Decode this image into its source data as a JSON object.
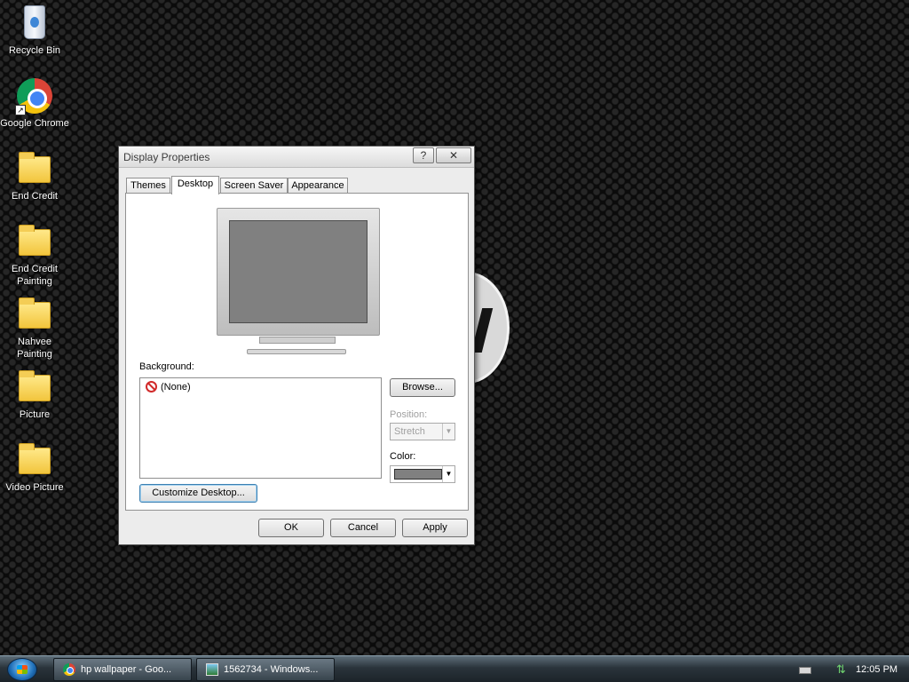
{
  "desktop": {
    "icons": [
      {
        "label": "Recycle Bin",
        "icon": "recycle-bin-icon"
      },
      {
        "label": "Google Chrome",
        "icon": "chrome-icon"
      },
      {
        "label": "End Credit",
        "icon": "folder-icon"
      },
      {
        "label": "End Credit Painting",
        "icon": "folder-icon"
      },
      {
        "label": "Nahvee Painting",
        "icon": "folder-icon"
      },
      {
        "label": "Picture",
        "icon": "folder-icon"
      },
      {
        "label": "Video Picture",
        "icon": "folder-icon"
      }
    ]
  },
  "dialog": {
    "title": "Display Properties",
    "help_glyph": "?",
    "close_glyph": "✕",
    "tabs": [
      "Themes",
      "Desktop",
      "Screen Saver",
      "Appearance"
    ],
    "active_tab": "Desktop",
    "background_label": "Background:",
    "background_items": [
      "(None)"
    ],
    "browse_label": "Browse...",
    "position_label": "Position:",
    "position_value": "Stretch",
    "color_label": "Color:",
    "color_value": "#808080",
    "customize_label": "Customize Desktop...",
    "ok_label": "OK",
    "cancel_label": "Cancel",
    "apply_label": "Apply"
  },
  "taskbar": {
    "tasks": [
      {
        "label": "hp wallpaper - Goo...",
        "icon": "chrome-icon"
      },
      {
        "label": "1562734 - Windows...",
        "icon": "picture-viewer-icon"
      }
    ],
    "clock": "12:05 PM"
  }
}
